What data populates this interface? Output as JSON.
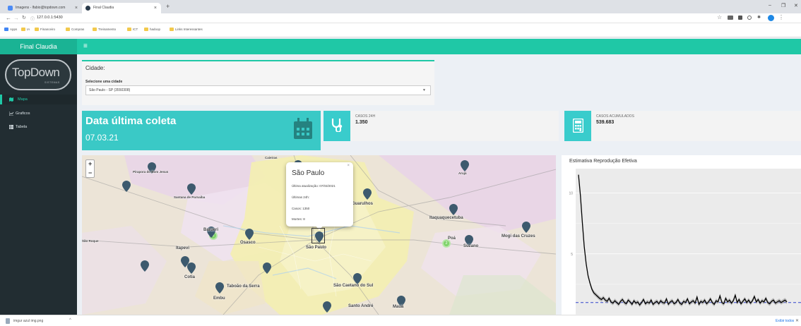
{
  "browser": {
    "tabs": [
      {
        "title": "Imagens - lfabio@topdown.com",
        "close": "×",
        "active": false
      },
      {
        "title": "Final Claudia",
        "close": "×",
        "active": true
      }
    ],
    "new_tab": "+",
    "url": "127.0.0.1:5430",
    "window_controls": {
      "minimize": "–",
      "restore": "❐",
      "close": "✕"
    },
    "bookmarks": [
      "Apps",
      "IA",
      "Financeiro",
      "Compras",
      "Treinamento",
      "ICT",
      "hadoop",
      "Links Interessantes"
    ]
  },
  "app": {
    "title": "Final Claudia",
    "hamburger": "≡",
    "logo_text": "TopDown",
    "logo_sub": "SISTEMAS"
  },
  "sidebar": {
    "items": [
      {
        "label": "Mapa",
        "icon": "map-icon",
        "active": true
      },
      {
        "label": "Graficos",
        "icon": "line-chart-icon",
        "active": false
      },
      {
        "label": "Tabela",
        "icon": "table-icon",
        "active": false
      }
    ]
  },
  "city": {
    "header": "Cidade:",
    "select_label": "Selecione uma cidade",
    "selected": "São Paulo - SP (3550308)"
  },
  "date_box": {
    "title": "Data última coleta",
    "value": "07.03.21"
  },
  "info_boxes": [
    {
      "label": "CASOS 24H",
      "value": "1.350",
      "icon": "stethoscope-icon"
    },
    {
      "label": "CASOS ACUMULADOS",
      "value": "539.683",
      "icon": "calculator-icon"
    }
  ],
  "map": {
    "zoom_in": "+",
    "zoom_out": "−",
    "popup": {
      "title": "São Paulo",
      "lines": [
        "Última atualização: 07/03/2021",
        "Últimas 24h:",
        "Casos: 1350",
        "Mortes: 8"
      ],
      "close": "×"
    },
    "cluster_labels": [
      "2",
      "2"
    ],
    "labels": [
      {
        "text": "Pirapora do Bom Jesus",
        "small": true
      },
      {
        "text": "Santana de Parnaíba",
        "small": true
      },
      {
        "text": "Caieiras",
        "small": true
      },
      {
        "text": "Arujá",
        "small": true
      },
      {
        "text": "Guarulhos",
        "small": false
      },
      {
        "text": "Itaquaquecetuba",
        "small": false
      },
      {
        "text": "Mogi das Cruzes",
        "small": false
      },
      {
        "text": "Poá",
        "small": false
      },
      {
        "text": "Suzano",
        "small": false
      },
      {
        "text": "Barueri",
        "small": false
      },
      {
        "text": "Osasco",
        "small": false
      },
      {
        "text": "São Paulo",
        "small": false
      },
      {
        "text": "Itapevi",
        "small": false
      },
      {
        "text": "São Roque",
        "small": true
      },
      {
        "text": "Cotia",
        "small": false
      },
      {
        "text": "Taboão da Serra",
        "small": false
      },
      {
        "text": "São Caetano do Sul",
        "small": false
      },
      {
        "text": "Embu",
        "small": false
      },
      {
        "text": "Santo André",
        "small": false
      },
      {
        "text": "Mauá",
        "small": false
      }
    ]
  },
  "chart_data": {
    "type": "line",
    "title": "Estimativa Reprodução Efetiva",
    "xlabel": "",
    "ylabel": "",
    "yticks": [
      "10",
      "5"
    ],
    "ylim": [
      0,
      12
    ],
    "reference_line": 1,
    "grid": true,
    "series": [
      {
        "values": [
          11.5,
          9.8,
          7.6,
          5.6,
          4.2,
          3.2,
          2.6,
          2.1,
          1.8,
          1.65,
          1.5,
          1.35,
          1.25,
          1.4,
          1.2,
          1.1,
          1.35,
          1.05,
          0.95,
          1.15,
          1.0,
          0.85,
          1.1,
          1.25,
          1.0,
          0.9,
          1.2,
          1.05,
          0.85,
          1.15,
          0.95,
          1.05,
          0.8,
          1.0,
          1.25,
          0.9,
          1.05,
          0.95,
          1.2,
          0.85,
          1.0,
          1.1,
          0.9,
          1.15,
          1.0,
          0.95,
          1.3,
          0.85,
          1.05,
          1.15,
          0.9,
          1.0,
          1.25,
          0.95,
          0.85,
          1.1,
          1.0,
          1.3,
          0.9,
          1.05,
          1.15,
          0.95,
          1.45,
          0.85,
          1.1,
          1.0,
          1.2,
          0.9,
          1.05,
          1.3,
          1.0,
          0.85,
          1.15,
          1.05,
          1.55,
          1.0,
          0.9,
          1.35,
          1.05,
          1.2,
          0.95,
          1.15,
          1.6,
          1.0,
          1.25,
          0.9,
          1.1,
          1.3,
          1.0,
          1.2,
          0.95,
          1.15,
          1.5,
          1.05,
          1.25,
          0.95,
          1.15,
          1.05,
          1.35,
          1.0,
          0.9,
          1.1,
          1.2,
          0.95,
          1.05,
          1.15,
          1.0,
          1.1,
          1.2,
          1.05
        ]
      }
    ]
  },
  "downloads": {
    "file": "imgur azul img.png",
    "chevron": "^",
    "show_all": "Exibir todos",
    "close": "✕"
  }
}
